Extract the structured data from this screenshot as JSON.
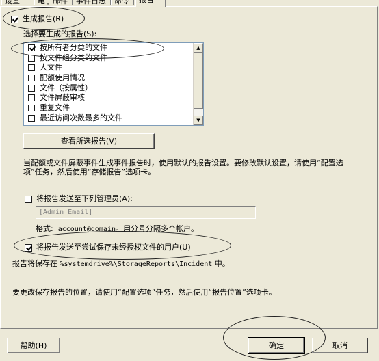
{
  "tabs": [
    "设置",
    "电子邮件",
    "事件日志",
    "命令",
    "报告"
  ],
  "generate_report": {
    "label": "生成报告(R)",
    "checked": true
  },
  "select_reports_label": "选择要生成的报告(S):",
  "report_list": [
    {
      "label": "按所有者分类的文件",
      "checked": true
    },
    {
      "label": "按文件组分类的文件",
      "checked": false
    },
    {
      "label": "大文件",
      "checked": false
    },
    {
      "label": "配额使用情况",
      "checked": false
    },
    {
      "label": "文件（按属性）",
      "checked": false
    },
    {
      "label": "文件屏蔽审核",
      "checked": false
    },
    {
      "label": "重复文件",
      "checked": false
    },
    {
      "label": "最近访问次数最多的文件",
      "checked": false
    }
  ],
  "review_button": "查看所选报告(V)",
  "description_lines": [
    "当配额或文件屏蔽事件生成事件报告时，使用默认的报告设置。要修改默认设置，请使用“配置选",
    "项”任务，然后使用“存储报告”选项卡。"
  ],
  "send_admin": {
    "label": "将报告发送至下列管理员(A):",
    "checked": false
  },
  "admin_email_value": "[Admin Email]",
  "format_label": "格式:",
  "format_value": "account@domain",
  "format_suffix": "。用分号分隔多个帐户。",
  "send_user": {
    "label": "将报告发送至尝试保存未经授权文件的用户(U)",
    "checked": true
  },
  "save_location_prefix": "报告将保存在",
  "save_location_path": "%systemdrive%\\StorageReports\\Incident",
  "save_location_suffix": "中。",
  "change_location_text": "要更改保存报告的位置，请使用“配置选项”任务，然后使用“报告位置”选项卡。",
  "footer": {
    "help": "帮助(H)",
    "ok": "确定",
    "cancel": "取消"
  }
}
